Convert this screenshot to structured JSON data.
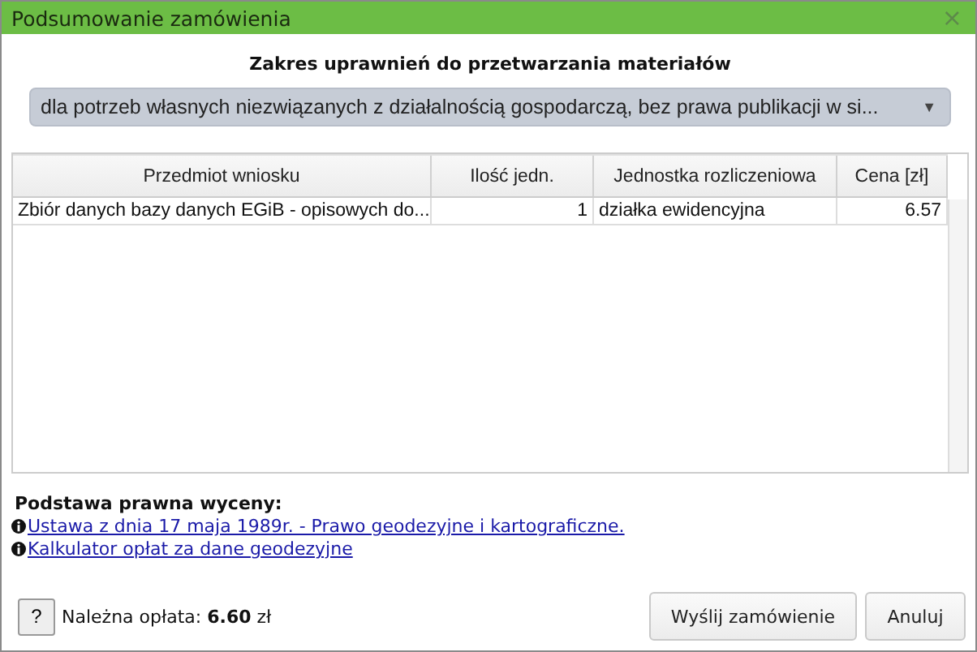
{
  "window": {
    "title": "Podsumowanie zamówienia",
    "close": "×"
  },
  "scope": {
    "heading": "Zakres uprawnień do przetwarzania materiałów",
    "value": "dla potrzeb własnych niezwiązanych z działalnością gospodarczą, bez prawa publikacji w si...",
    "arrow": "▼"
  },
  "table": {
    "columns": [
      "Przedmiot wniosku",
      "Ilość jedn.",
      "Jednostka rozliczeniowa",
      "Cena [zł]"
    ],
    "rows": [
      [
        "Zbiór danych bazy danych EGiB - opisowych do...",
        "1",
        "działka ewidencyjna",
        "6.57"
      ]
    ]
  },
  "legal": {
    "heading": "Podstawa prawna wyceny:",
    "links": [
      "Ustawa z dnia 17 maja 1989r. - Prawo geodezyjne i kartograficzne.",
      "Kalkulator opłat za dane geodezyjne"
    ]
  },
  "footer": {
    "help": "?",
    "fee": "Należna opłata: **6.60** zł",
    "buttons": [
      "Wyślij zamówienie",
      "Anuluj"
    ]
  }
}
